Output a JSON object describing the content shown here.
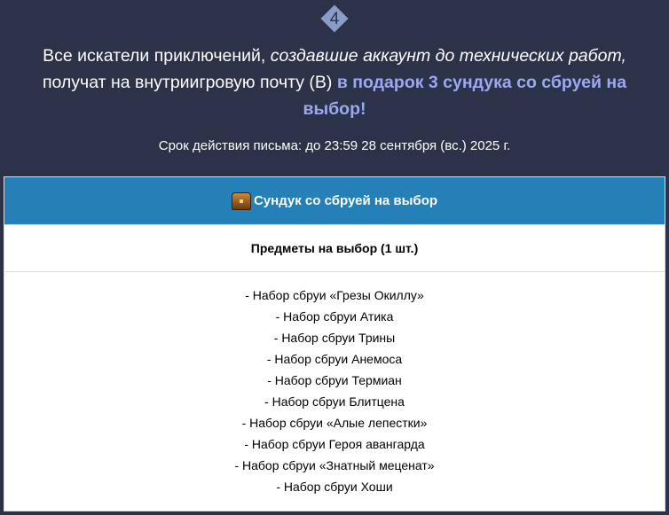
{
  "badge": "4",
  "title": {
    "part1": "Все искатели приключений, ",
    "italic": "создавшие аккаунт до технических работ,",
    "part2": " получат на внутриигровую почту (В) ",
    "highlight": "в подарок 3 сундука со сбруей на выбор!"
  },
  "expiry": "Срок действия письма: до 23:59 28 сентября (вс.) 2025 г.",
  "table": {
    "header": "Сундук со сбруей на выбор",
    "subheader": "Предметы на выбор (1 шт.)",
    "items": [
      "- Набор сбруи «Грезы Окиллу»",
      "- Набор сбруи Атика",
      "- Набор сбруи Трины",
      "- Набор сбруи Анемоса",
      "- Набор сбруи Термиан",
      "- Набор сбруи Блитцена",
      "- Набор сбруи «Алые лепестки»",
      "- Набор сбруи Героя авангарда",
      "- Набор сбруи «Знатный меценат»",
      "- Набор сбруи Хоши"
    ]
  }
}
